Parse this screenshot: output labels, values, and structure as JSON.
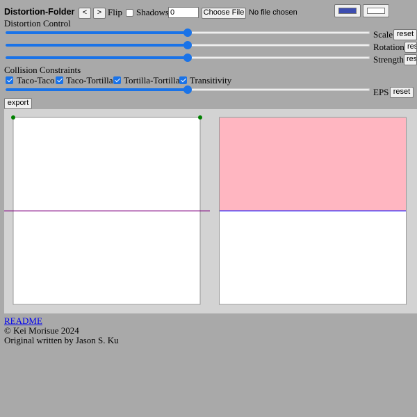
{
  "app": {
    "title": "Distortion-Folder"
  },
  "toolbar": {
    "prev_label": "<",
    "next_label": ">",
    "flip_label": "Flip",
    "flip_checked": false,
    "shadows_label": "Shadows",
    "shadows_checked": false,
    "shadows_value": "0",
    "file_button_label": "Choose File",
    "file_status": "No file chosen",
    "color_primary": "#3d4db0",
    "color_secondary": "#ffffff"
  },
  "distortion": {
    "heading": "Distortion Control",
    "sliders": [
      {
        "label": "Scale",
        "reset": "reset",
        "value": 0.5
      },
      {
        "label": "Rotation",
        "reset": "reset",
        "value": 0.5
      },
      {
        "label": "Strength",
        "reset": "reset",
        "value": 0.5
      }
    ]
  },
  "collision": {
    "heading": "Collision Constraints",
    "options": [
      {
        "label": "Taco-Taco",
        "checked": true
      },
      {
        "label": "Taco-Tortilla",
        "checked": true
      },
      {
        "label": "Tortilla-Tortilla",
        "checked": true
      },
      {
        "label": "Transitivity",
        "checked": true
      }
    ],
    "eps": {
      "label": "EPS",
      "reset": "reset",
      "value": 0.5
    }
  },
  "export_label": "export",
  "colors": {
    "page_bg": "#a9a9a9",
    "canvas_bg": "#d3d3d3",
    "paper": "#ffffff",
    "folded_top": "#ffb6c1",
    "crease_left": "#800080",
    "crease_right": "#0000ff",
    "vertex_dot": "#008000"
  },
  "footer": {
    "readme_label": "README",
    "copyright": "© Kei Morisue 2024",
    "credit": "Original written by Jason S. Ku"
  }
}
